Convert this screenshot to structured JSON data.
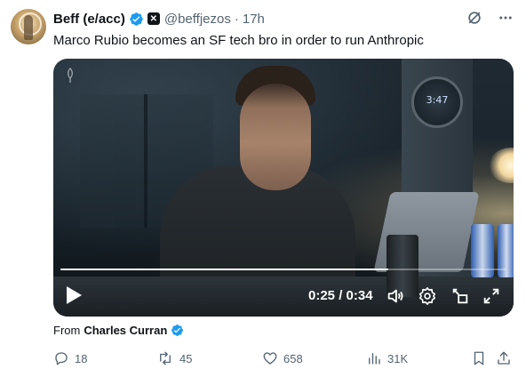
{
  "tweet": {
    "author_name": "Beff (e/acc)",
    "handle": "@beffjezos",
    "separator": "·",
    "time": "17h",
    "text": "Marco Rubio becomes an SF tech bro in order to run Anthropic",
    "verified_color": "#1d9bf0"
  },
  "media": {
    "clock_text": "3:47",
    "timecode": "0:25 / 0:34",
    "progress_fraction": 0.735
  },
  "attribution": {
    "prefix": "From",
    "name": "Charles Curran"
  },
  "actions": {
    "replies": "18",
    "reposts": "45",
    "likes": "658",
    "views": "31K"
  },
  "icons": {
    "top": [
      "grok-icon",
      "more-icon"
    ],
    "video": [
      "play-icon",
      "volume-icon",
      "settings-icon",
      "pip-icon",
      "fullscreen-icon"
    ],
    "actions": [
      "reply-icon",
      "repost-icon",
      "like-icon",
      "views-icon",
      "bookmark-icon",
      "share-icon"
    ]
  },
  "colors": {
    "text": "#0f1419",
    "secondary": "#536471",
    "accent": "#1d9bf0"
  }
}
